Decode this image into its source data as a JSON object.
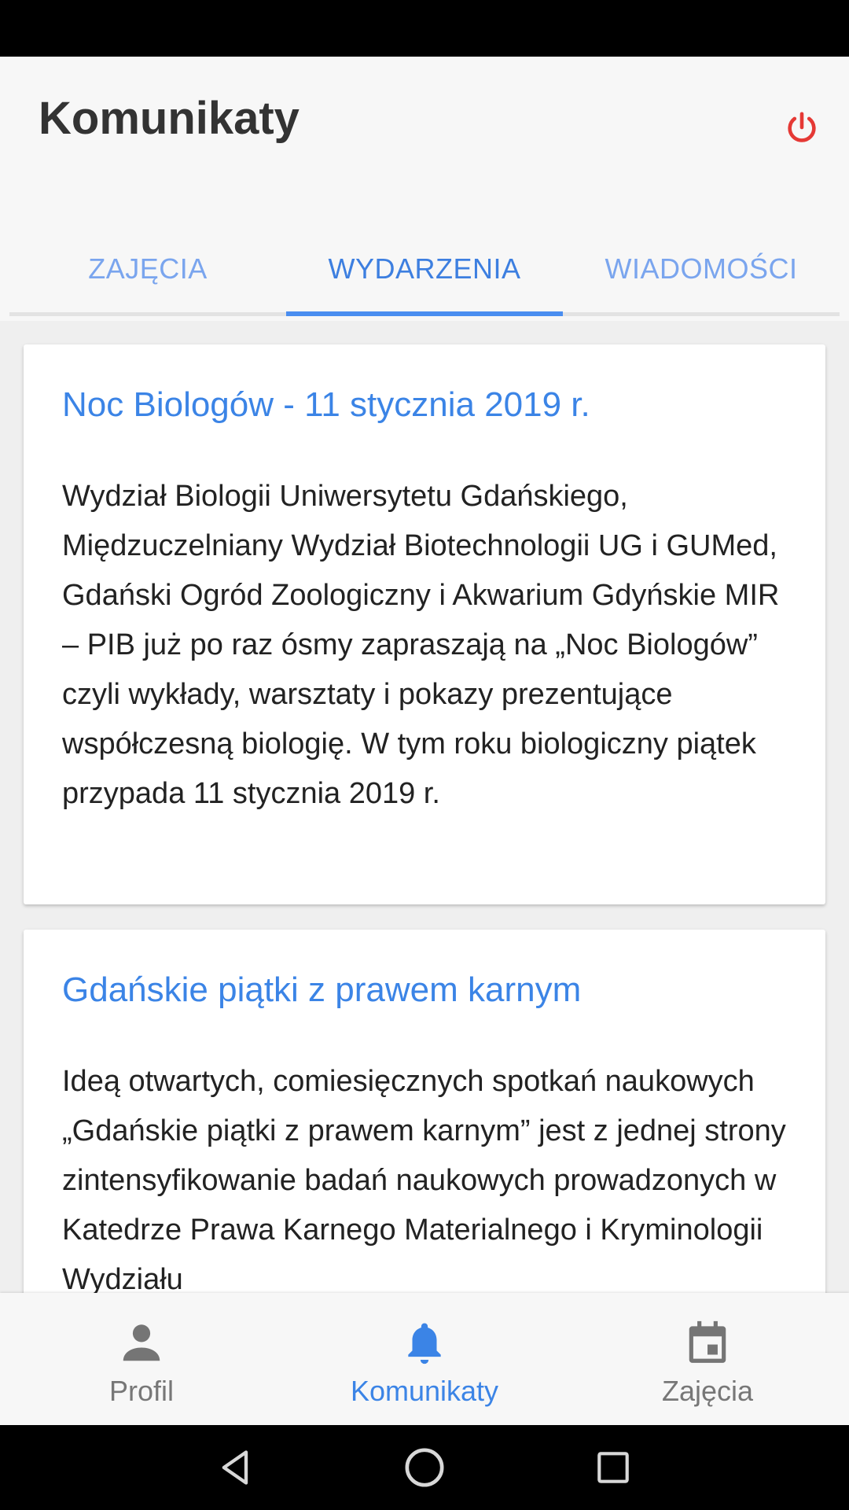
{
  "header": {
    "title": "Komunikaty",
    "logout_icon": "power-icon",
    "logout_color": "#e53935"
  },
  "tabs": [
    {
      "label": "ZAJĘCIA",
      "active": false
    },
    {
      "label": "WYDARZENIA",
      "active": true
    },
    {
      "label": "WIADOMOŚCI",
      "active": false
    }
  ],
  "cards": [
    {
      "title": "Noc Biologów - 11 stycznia 2019 r.",
      "body": "Wydział Biologii Uniwersytetu Gdańskiego, Międzuczelniany Wydział Biotechnologii UG i GUMed, Gdański Ogród Zoologiczny i Akwarium Gdyńskie MIR – PIB już po raz ósmy zapraszają na „Noc Biologów” czyli wykłady, warsztaty i pokazy prezentujące współczesną biologię. W tym roku biologiczny piątek przypada 11 stycznia 2019 r."
    },
    {
      "title": "Gdańskie piątki z prawem karnym",
      "body": "Ideą otwartych, comiesięcznych spotkań naukowych „Gdańskie piątki z prawem karnym” jest z jednej strony zintensyfikowanie badań naukowych prowadzonych w Katedrze Prawa Karnego Materialnego i Kryminologii Wydziału"
    }
  ],
  "bottom_nav": [
    {
      "label": "Profil",
      "icon": "person-icon",
      "active": false
    },
    {
      "label": "Komunikaty",
      "icon": "bell-icon",
      "active": true
    },
    {
      "label": "Zajęcia",
      "icon": "calendar-icon",
      "active": false
    }
  ],
  "colors": {
    "accent": "#3b84e6",
    "tab_inactive": "#7aa5ee",
    "nav_inactive": "#777777"
  }
}
